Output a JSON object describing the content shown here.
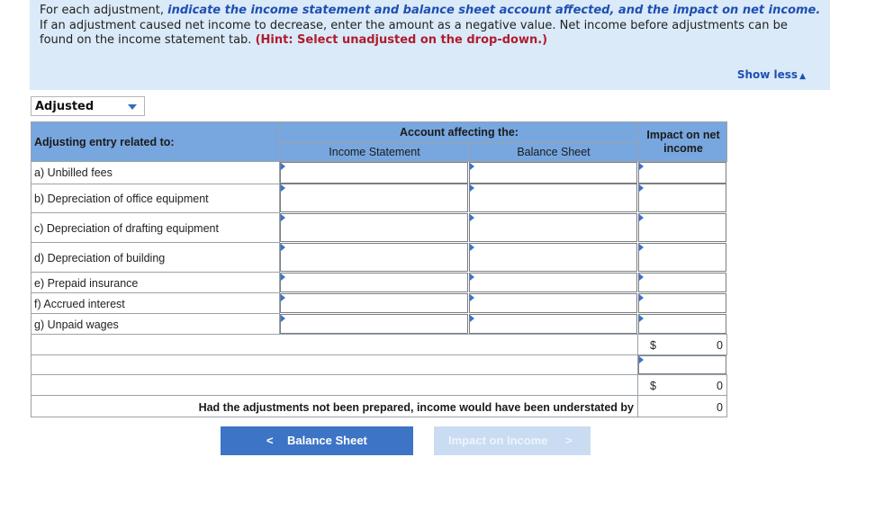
{
  "instructions": {
    "part1": "For each adjustment, ",
    "part2_emphasis": "indicate the income statement and balance sheet account affected, and the impact on net income.",
    "part3": "If an adjustment caused net income to decrease, enter the amount as a negative value. Net income before adjustments can be found on the income statement tab. ",
    "hint": "(Hint: Select unadjusted on the drop-down.)",
    "show_less": "Show less",
    "show_less_icon": "▲"
  },
  "dropdown": {
    "selected": "Adjusted"
  },
  "table": {
    "col_entry": "Adjusting entry related to:",
    "col_group": "Account affecting the:",
    "col_income_statement": "Income Statement",
    "col_balance_sheet": "Balance Sheet",
    "col_impact": "Impact on net income",
    "rows": [
      "a) Unbilled fees",
      "b) Depreciation of office equipment",
      "c) Depreciation of drafting equipment",
      "d) Depreciation of building",
      "e) Prepaid insurance",
      "f) Accrued interest",
      "g) Unpaid wages"
    ],
    "subtotal": {
      "currency": "$",
      "value": "0"
    },
    "total": {
      "currency": "$",
      "value": "0"
    },
    "understated_label": "Had the adjustments not been prepared, income would have been understated by",
    "understated_value": "0"
  },
  "nav": {
    "prev_label": "Balance Sheet",
    "prev_icon": "<",
    "next_label": "Impact on Income",
    "next_icon": ">"
  },
  "colors": {
    "header_blue": "#78a7df",
    "instruction_bg": "#daeaf8",
    "button_blue": "#3e74c6",
    "button_disabled": "#c9dcf2"
  }
}
